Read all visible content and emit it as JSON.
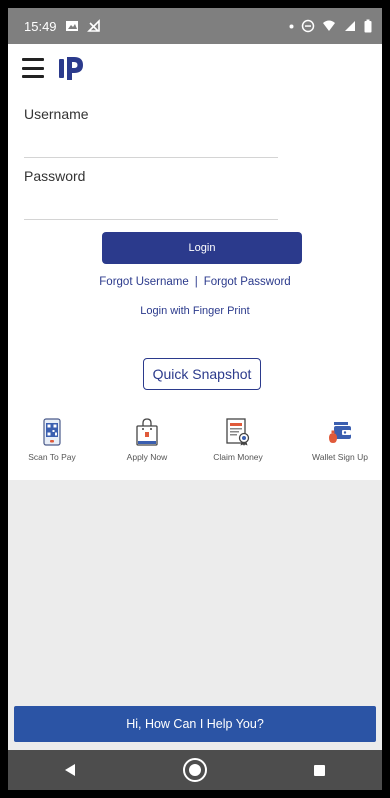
{
  "status_bar": {
    "time": "15:49"
  },
  "login": {
    "username_label": "Username",
    "password_label": "Password",
    "login_button": "Login",
    "forgot_username": "Forgot Username",
    "separator": "|",
    "forgot_password": "Forgot Password",
    "finger_print": "Login with Finger Print",
    "quick_snapshot": "Quick Snapshot"
  },
  "shortcuts": [
    {
      "label": "Scan To Pay",
      "icon": "qr-phone-icon"
    },
    {
      "label": "Apply Now",
      "icon": "shopping-bag-icon"
    },
    {
      "label": "Claim Money",
      "icon": "certificate-icon"
    },
    {
      "label": "Wallet Sign Up",
      "icon": "wallet-icon"
    }
  ],
  "help": {
    "text": "Hi, How Can I Help You?"
  },
  "colors": {
    "primary": "#2b3a8c",
    "help_bar": "#2b54a5",
    "status_bar": "#7f7f7f",
    "nav_bar": "#4d4d4d"
  }
}
